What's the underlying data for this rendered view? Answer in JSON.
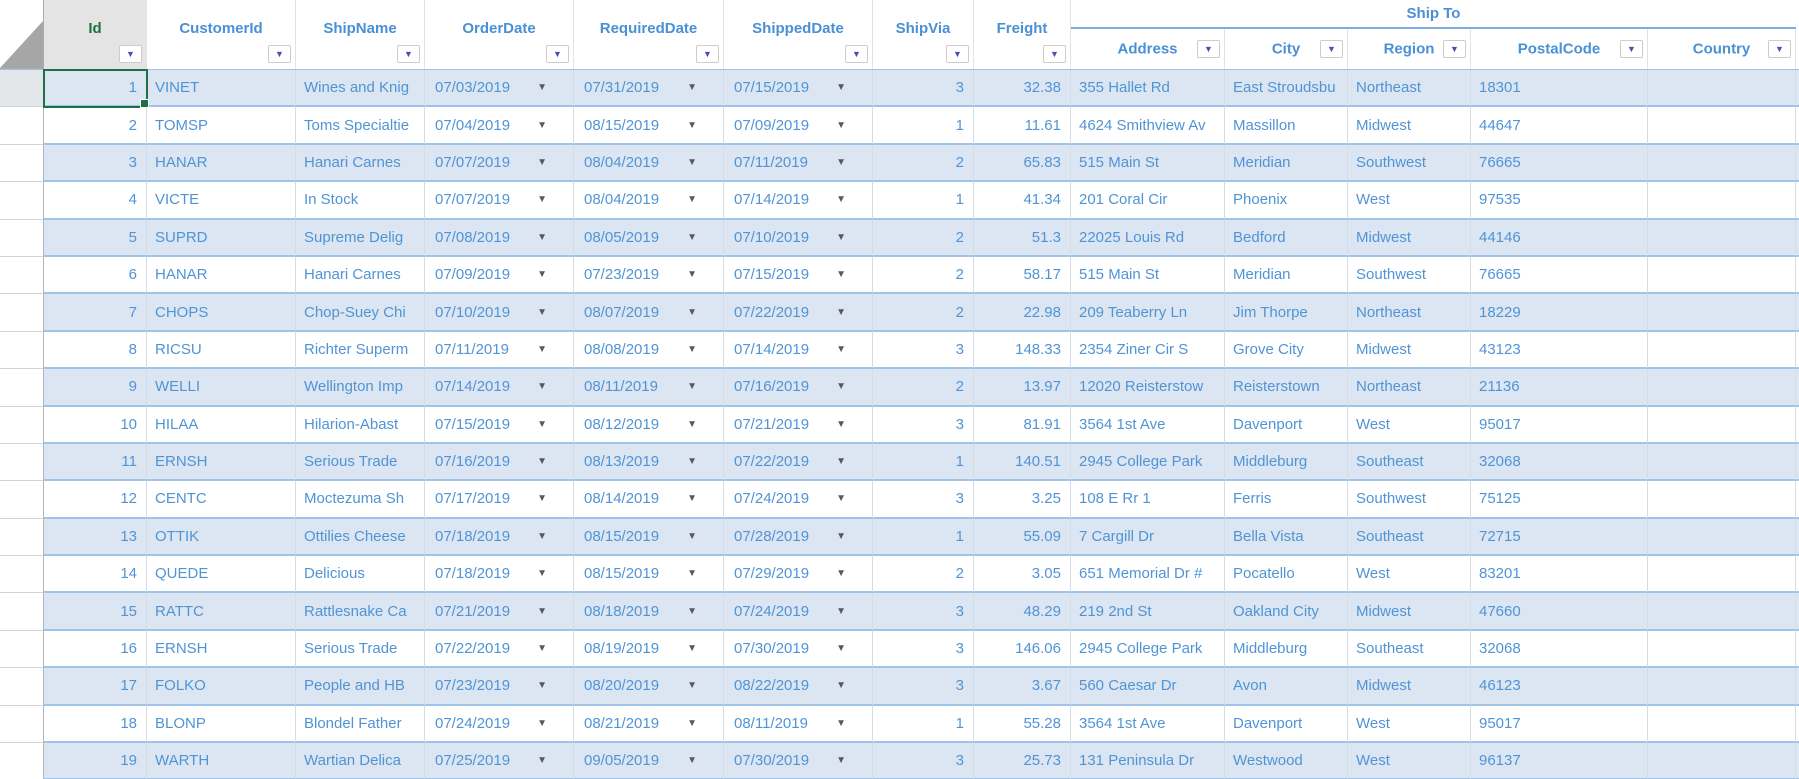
{
  "headers": {
    "group_label": "Ship To",
    "columns": [
      {
        "key": "id",
        "label": "Id",
        "active": true
      },
      {
        "key": "customerId",
        "label": "CustomerId"
      },
      {
        "key": "shipName",
        "label": "ShipName"
      },
      {
        "key": "orderDate",
        "label": "OrderDate"
      },
      {
        "key": "requiredDate",
        "label": "RequiredDate"
      },
      {
        "key": "shippedDate",
        "label": "ShippedDate"
      },
      {
        "key": "shipVia",
        "label": "ShipVia"
      },
      {
        "key": "freight",
        "label": "Freight"
      },
      {
        "key": "address",
        "label": "Address",
        "group": "Ship To"
      },
      {
        "key": "city",
        "label": "City",
        "group": "Ship To"
      },
      {
        "key": "region",
        "label": "Region",
        "group": "Ship To"
      },
      {
        "key": "postalCode",
        "label": "PostalCode",
        "group": "Ship To"
      },
      {
        "key": "country",
        "label": "Country",
        "group": "Ship To"
      }
    ]
  },
  "selection": {
    "active_cell_row_id": 1,
    "active_cell_column": "Id"
  },
  "icons": {
    "filter_arrow": "▼",
    "cell_dropdown": "▼",
    "select_all_corner": "gray-triangle"
  },
  "colors": {
    "accent_text": "#5094d6",
    "alt_row_fill": "#dbe6f2",
    "row_border": "#9fc4e7",
    "selection_green": "#1e7145",
    "active_header_bg": "#e4e4e4",
    "filter_arrow": "#4653a8",
    "corner_triangle": "#a6a6a6"
  },
  "rows": [
    {
      "id": 1,
      "customerId": "VINET",
      "shipName": "Wines and Knig",
      "orderDate": "07/03/2019",
      "requiredDate": "07/31/2019",
      "shippedDate": "07/15/2019",
      "shipVia": 3,
      "freight": "32.38",
      "address": "355 Hallet Rd",
      "city": "East Stroudsbu",
      "region": "Northeast",
      "postalCode": "18301",
      "country": ""
    },
    {
      "id": 2,
      "customerId": "TOMSP",
      "shipName": "Toms Specialtie",
      "orderDate": "07/04/2019",
      "requiredDate": "08/15/2019",
      "shippedDate": "07/09/2019",
      "shipVia": 1,
      "freight": "11.61",
      "address": "4624 Smithview Av",
      "city": "Massillon",
      "region": "Midwest",
      "postalCode": "44647",
      "country": ""
    },
    {
      "id": 3,
      "customerId": "HANAR",
      "shipName": "Hanari Carnes",
      "orderDate": "07/07/2019",
      "requiredDate": "08/04/2019",
      "shippedDate": "07/11/2019",
      "shipVia": 2,
      "freight": "65.83",
      "address": "515 Main St",
      "city": "Meridian",
      "region": "Southwest",
      "postalCode": "76665",
      "country": ""
    },
    {
      "id": 4,
      "customerId": "VICTE",
      "shipName": "In Stock",
      "orderDate": "07/07/2019",
      "requiredDate": "08/04/2019",
      "shippedDate": "07/14/2019",
      "shipVia": 1,
      "freight": "41.34",
      "address": "201 Coral Cir",
      "city": "Phoenix",
      "region": "West",
      "postalCode": "97535",
      "country": ""
    },
    {
      "id": 5,
      "customerId": "SUPRD",
      "shipName": "Supreme Delig",
      "orderDate": "07/08/2019",
      "requiredDate": "08/05/2019",
      "shippedDate": "07/10/2019",
      "shipVia": 2,
      "freight": "51.3",
      "address": "22025 Louis Rd",
      "city": "Bedford",
      "region": "Midwest",
      "postalCode": "44146",
      "country": ""
    },
    {
      "id": 6,
      "customerId": "HANAR",
      "shipName": "Hanari Carnes",
      "orderDate": "07/09/2019",
      "requiredDate": "07/23/2019",
      "shippedDate": "07/15/2019",
      "shipVia": 2,
      "freight": "58.17",
      "address": "515 Main St",
      "city": "Meridian",
      "region": "Southwest",
      "postalCode": "76665",
      "country": ""
    },
    {
      "id": 7,
      "customerId": "CHOPS",
      "shipName": "Chop-Suey Chi",
      "orderDate": "07/10/2019",
      "requiredDate": "08/07/2019",
      "shippedDate": "07/22/2019",
      "shipVia": 2,
      "freight": "22.98",
      "address": "209 Teaberry Ln",
      "city": "Jim Thorpe",
      "region": "Northeast",
      "postalCode": "18229",
      "country": ""
    },
    {
      "id": 8,
      "customerId": "RICSU",
      "shipName": "Richter Superm",
      "orderDate": "07/11/2019",
      "requiredDate": "08/08/2019",
      "shippedDate": "07/14/2019",
      "shipVia": 3,
      "freight": "148.33",
      "address": "2354 Ziner Cir S",
      "city": "Grove City",
      "region": "Midwest",
      "postalCode": "43123",
      "country": ""
    },
    {
      "id": 9,
      "customerId": "WELLI",
      "shipName": "Wellington Imp",
      "orderDate": "07/14/2019",
      "requiredDate": "08/11/2019",
      "shippedDate": "07/16/2019",
      "shipVia": 2,
      "freight": "13.97",
      "address": "12020 Reisterstow",
      "city": "Reisterstown",
      "region": "Northeast",
      "postalCode": "21136",
      "country": ""
    },
    {
      "id": 10,
      "customerId": "HILAA",
      "shipName": "Hilarion-Abast",
      "orderDate": "07/15/2019",
      "requiredDate": "08/12/2019",
      "shippedDate": "07/21/2019",
      "shipVia": 3,
      "freight": "81.91",
      "address": "3564 1st Ave",
      "city": "Davenport",
      "region": "West",
      "postalCode": "95017",
      "country": ""
    },
    {
      "id": 11,
      "customerId": "ERNSH",
      "shipName": "Serious Trade",
      "orderDate": "07/16/2019",
      "requiredDate": "08/13/2019",
      "shippedDate": "07/22/2019",
      "shipVia": 1,
      "freight": "140.51",
      "address": "2945 College Park",
      "city": "Middleburg",
      "region": "Southeast",
      "postalCode": "32068",
      "country": ""
    },
    {
      "id": 12,
      "customerId": "CENTC",
      "shipName": "Moctezuma Sh",
      "orderDate": "07/17/2019",
      "requiredDate": "08/14/2019",
      "shippedDate": "07/24/2019",
      "shipVia": 3,
      "freight": "3.25",
      "address": "108 E Rr 1",
      "city": "Ferris",
      "region": "Southwest",
      "postalCode": "75125",
      "country": ""
    },
    {
      "id": 13,
      "customerId": "OTTIK",
      "shipName": "Ottilies Cheese",
      "orderDate": "07/18/2019",
      "requiredDate": "08/15/2019",
      "shippedDate": "07/28/2019",
      "shipVia": 1,
      "freight": "55.09",
      "address": "7 Cargill Dr",
      "city": "Bella Vista",
      "region": "Southeast",
      "postalCode": "72715",
      "country": ""
    },
    {
      "id": 14,
      "customerId": "QUEDE",
      "shipName": "Delicious",
      "orderDate": "07/18/2019",
      "requiredDate": "08/15/2019",
      "shippedDate": "07/29/2019",
      "shipVia": 2,
      "freight": "3.05",
      "address": "651 Memorial Dr #",
      "city": "Pocatello",
      "region": "West",
      "postalCode": "83201",
      "country": ""
    },
    {
      "id": 15,
      "customerId": "RATTC",
      "shipName": "Rattlesnake Ca",
      "orderDate": "07/21/2019",
      "requiredDate": "08/18/2019",
      "shippedDate": "07/24/2019",
      "shipVia": 3,
      "freight": "48.29",
      "address": "219 2nd St",
      "city": "Oakland City",
      "region": "Midwest",
      "postalCode": "47660",
      "country": ""
    },
    {
      "id": 16,
      "customerId": "ERNSH",
      "shipName": "Serious Trade",
      "orderDate": "07/22/2019",
      "requiredDate": "08/19/2019",
      "shippedDate": "07/30/2019",
      "shipVia": 3,
      "freight": "146.06",
      "address": "2945 College Park",
      "city": "Middleburg",
      "region": "Southeast",
      "postalCode": "32068",
      "country": ""
    },
    {
      "id": 17,
      "customerId": "FOLKO",
      "shipName": "People and HB",
      "orderDate": "07/23/2019",
      "requiredDate": "08/20/2019",
      "shippedDate": "08/22/2019",
      "shipVia": 3,
      "freight": "3.67",
      "address": "560 Caesar Dr",
      "city": "Avon",
      "region": "Midwest",
      "postalCode": "46123",
      "country": ""
    },
    {
      "id": 18,
      "customerId": "BLONP",
      "shipName": "Blondel Father",
      "orderDate": "07/24/2019",
      "requiredDate": "08/21/2019",
      "shippedDate": "08/11/2019",
      "shipVia": 1,
      "freight": "55.28",
      "address": "3564 1st Ave",
      "city": "Davenport",
      "region": "West",
      "postalCode": "95017",
      "country": ""
    },
    {
      "id": 19,
      "customerId": "WARTH",
      "shipName": "Wartian Delica",
      "orderDate": "07/25/2019",
      "requiredDate": "09/05/2019",
      "shippedDate": "07/30/2019",
      "shipVia": 3,
      "freight": "25.73",
      "address": "131 Peninsula Dr",
      "city": "Westwood",
      "region": "West",
      "postalCode": "96137",
      "country": ""
    }
  ]
}
